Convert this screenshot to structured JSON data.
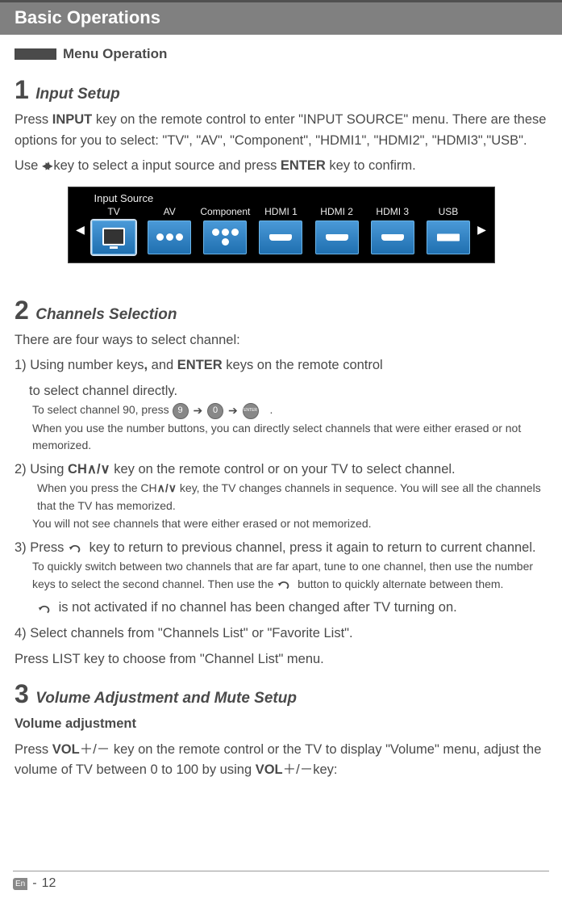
{
  "header": {
    "title": "Basic Operations"
  },
  "section": {
    "menu_op": "Menu Operation"
  },
  "step1": {
    "num": "1",
    "title": "Input Setup",
    "p1a": "Press ",
    "p1b": "INPUT",
    "p1c": " key on the remote control to enter \"INPUT SOURCE\" menu. There are these options for you to select:  \"TV\",  \"AV\",  \"Component\", \"HDMI1\", \"HDMI2\", \"HDMI3\",\"USB\".",
    "p2a": "Use ",
    "p2arrows": "◀/▶",
    "p2b": "key to select a input source and press ",
    "p2c": "ENTER",
    "p2d": " key to confirm."
  },
  "source_panel": {
    "title": "Input Source",
    "items": [
      "TV",
      "AV",
      "Component",
      "HDMI 1",
      "HDMI 2",
      "HDMI 3",
      "USB"
    ]
  },
  "step2": {
    "num": "2",
    "title": "Channels Selection",
    "intro": "There are four ways to select channel:",
    "m1a": "1) Using number keys",
    "m1b": ",",
    "m1c": " and ",
    "m1d": "ENTER",
    "m1e": " keys on the remote control",
    "m1f": "to select channel directly.",
    "m1_small_a": "To select channel 90, press",
    "m1_key9": "9",
    "m1_key0": "0",
    "m1_enter": "ENTER",
    "m1_small_end": ".",
    "m1_small_b": "When you use the number buttons, you can directly select channels that were either erased or not memorized.",
    "m2a": "2) Using ",
    "m2b": "CH",
    "m2c": " key on the remote control or on your TV to select channel.",
    "m2_small_a_pre": "When you press the ",
    "m2_small_a_ch": "CH",
    "m2_small_a_post": " key, the TV changes channels in sequence. You will see all the channels that the TV has memorized.",
    "m2_small_b": "You will not see channels that were either erased or not memorized.",
    "m3a": "3) Press ",
    "m3b": " key to return to previous channel, press it again to return to current channel.",
    "m3_small_a": "To quickly switch between two channels that are far apart, tune to one channel, then use the number keys to select the second channel. Then use the ",
    "m3_small_b": " button to quickly alternate between them.",
    "m3_line": " is not activated if no channel has been changed after TV turning on.",
    "m4": "4) Select channels from \"Channels List\" or \"Favorite List\".",
    "m4b": "Press LIST key to choose from \"Channel List\" menu."
  },
  "step3": {
    "num": "3",
    "title": "Volume Adjustment and Mute Setup",
    "sub": "Volume adjustment",
    "p_a": "Press ",
    "p_vol": "VOL",
    "p_pm": "＋/－",
    "p_b": " key on the remote control or the TV to display \"Volume\" menu, adjust the volume of TV between 0 to 100 by using ",
    "p_c": "key:"
  },
  "footer": {
    "lang": "En",
    "dash": "-",
    "page": "12"
  }
}
